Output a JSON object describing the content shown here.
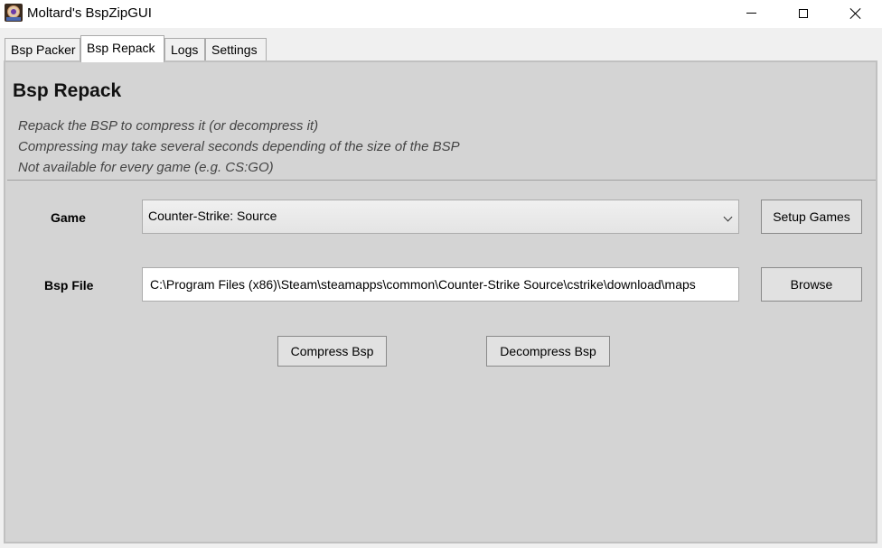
{
  "window": {
    "title": "Moltard's BspZipGUI"
  },
  "tabs": [
    {
      "label": "Bsp Packer",
      "active": false
    },
    {
      "label": "Bsp Repack",
      "active": true
    },
    {
      "label": "Logs",
      "active": false
    },
    {
      "label": "Settings",
      "active": false
    }
  ],
  "panel": {
    "heading": "Bsp Repack",
    "description": [
      "Repack the BSP to compress it (or decompress it)",
      "Compressing may take several seconds depending of the size of the BSP",
      "Not available for every game (e.g. CS:GO)"
    ],
    "game": {
      "label": "Game",
      "selected": "Counter-Strike: Source",
      "setup_label": "Setup Games"
    },
    "bsp_file": {
      "label": "Bsp File",
      "value": "C:\\Program Files (x86)\\Steam\\steamapps\\common\\Counter-Strike Source\\cstrike\\download\\maps",
      "browse_label": "Browse"
    },
    "actions": {
      "compress_label": "Compress Bsp",
      "decompress_label": "Decompress Bsp"
    }
  },
  "icons": {
    "app": "app-icon",
    "minimize": "minimize-icon",
    "maximize": "maximize-icon",
    "close": "close-icon",
    "dropdown": "chevron-down-icon"
  }
}
